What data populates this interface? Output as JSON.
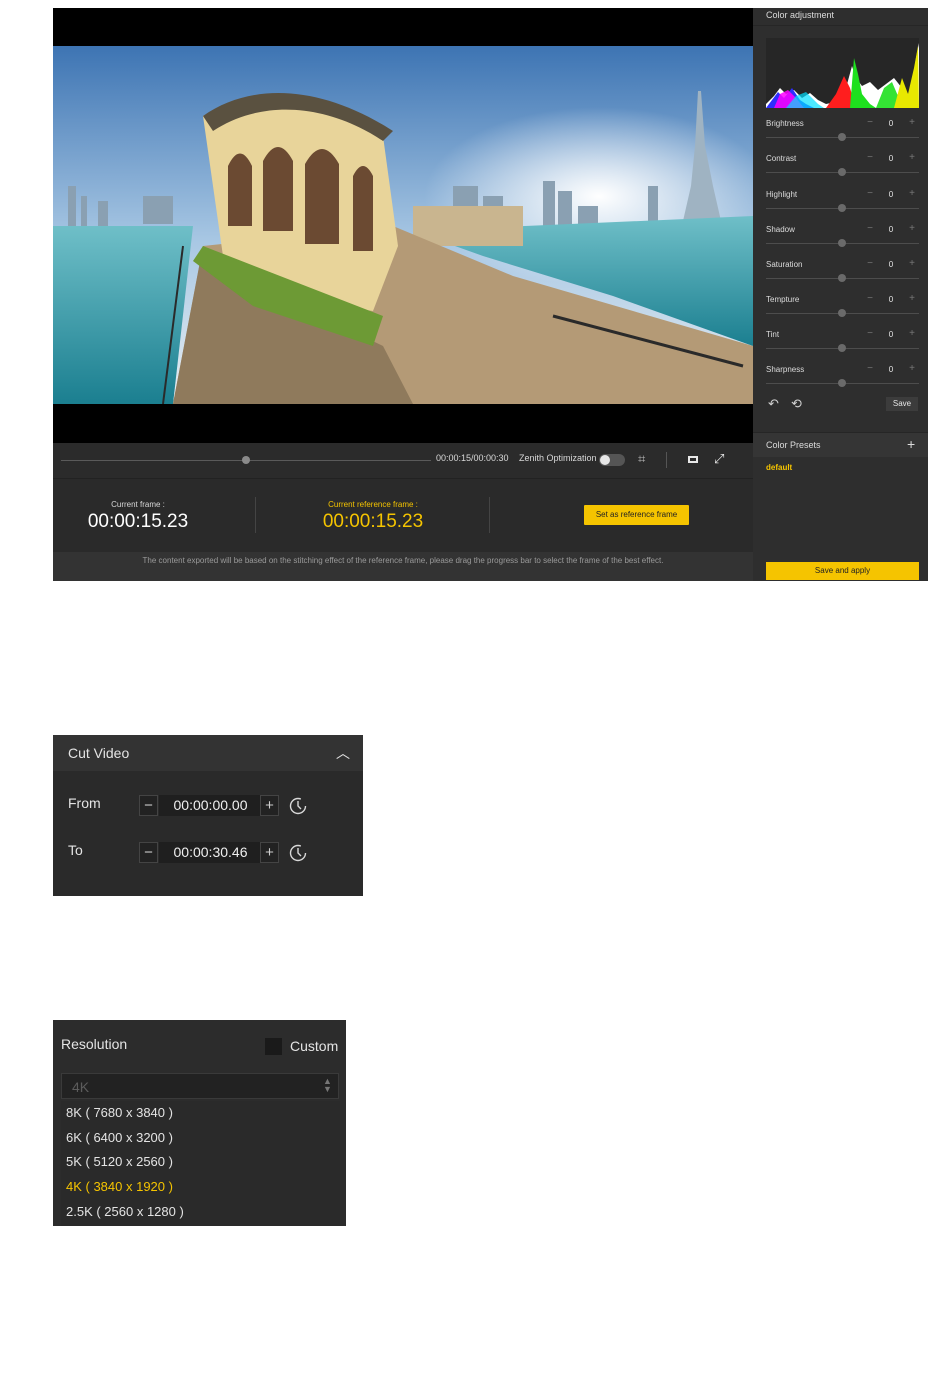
{
  "editor": {
    "playback": {
      "timecode": "00:00:15/00:00:30",
      "zenith_label": "Zenith Optimization"
    },
    "frames": {
      "current_label": "Current frame :",
      "current_time": "00:00:15.23",
      "reference_label": "Current reference frame :",
      "reference_time": "00:00:15.23",
      "set_reference_button": "Set as reference frame"
    },
    "notice": "The content exported will be based on the stitching effect of the reference frame, please drag the progress bar to select the frame of the best effect.",
    "color_panel": {
      "title": "Color adjustment",
      "sliders": [
        {
          "label": "Brightness",
          "value": "0"
        },
        {
          "label": "Contrast",
          "value": "0"
        },
        {
          "label": "Highlight",
          "value": "0"
        },
        {
          "label": "Shadow",
          "value": "0"
        },
        {
          "label": "Saturation",
          "value": "0"
        },
        {
          "label": "Tempture",
          "value": "0"
        },
        {
          "label": "Tint",
          "value": "0"
        },
        {
          "label": "Sharpness",
          "value": "0"
        }
      ],
      "save_label": "Save",
      "presets_title": "Color Presets",
      "presets_add": "+",
      "preset_default": "default",
      "save_apply_label": "Save and apply"
    }
  },
  "cut_video": {
    "title": "Cut Video",
    "from_label": "From",
    "from_value": "00:00:00.00",
    "to_label": "To",
    "to_value": "00:00:30.46"
  },
  "resolution": {
    "title": "Resolution",
    "custom_label": "Custom",
    "selected": "4K",
    "options": [
      {
        "label": "8K ( 7680 x 3840 )"
      },
      {
        "label": "6K ( 6400 x 3200 )"
      },
      {
        "label": "5K ( 5120 x 2560 )"
      },
      {
        "label": "4K ( 3840 x 1920 )"
      },
      {
        "label": "2.5K ( 2560 x 1280 )"
      }
    ],
    "highlight_color": "#f5c400"
  },
  "colors": {
    "accent": "#f5c400",
    "panel_bg": "#2e2e2e"
  }
}
